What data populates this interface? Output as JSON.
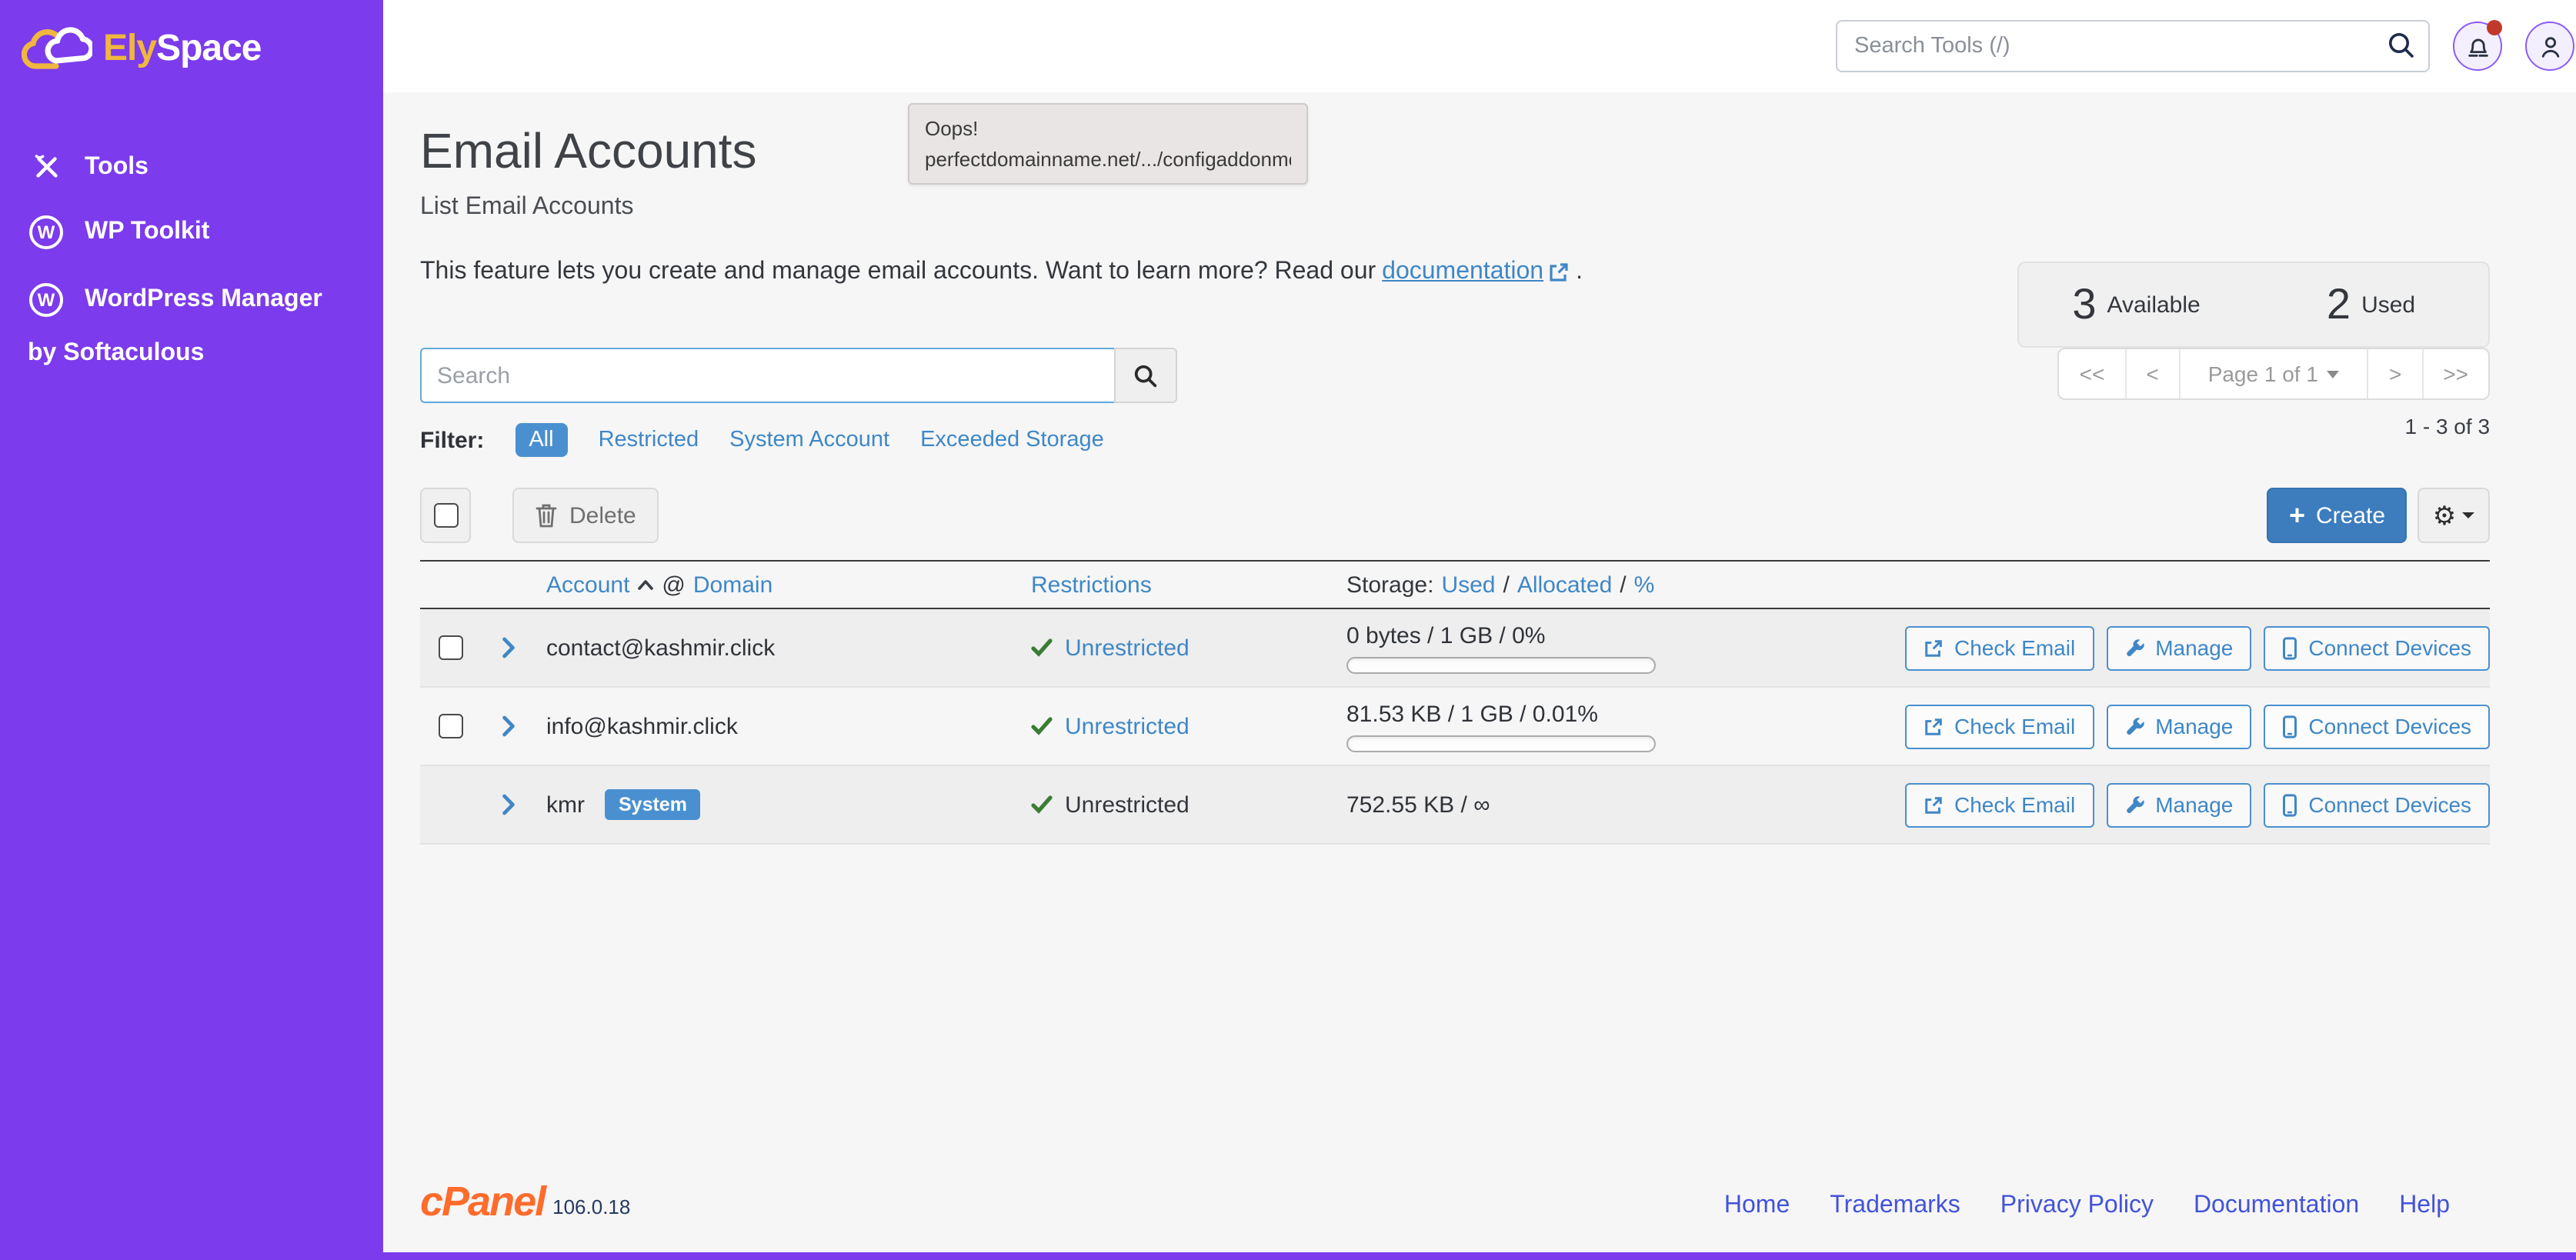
{
  "brand": {
    "name_primary": "Ely",
    "name_secondary": "Space"
  },
  "sidebar": {
    "items": [
      {
        "label": "Tools",
        "icon": "tools-icon"
      },
      {
        "label": "WP Toolkit",
        "icon": "wordpress-icon"
      },
      {
        "label": "WordPress Manager",
        "sublabel": "by Softaculous",
        "icon": "wordpress-icon"
      }
    ]
  },
  "topbar": {
    "search_placeholder": "Search Tools (/)"
  },
  "tooltip": {
    "line1": "Oops!",
    "line2": "perfectdomainname.net/.../configaddonmods...."
  },
  "page": {
    "title": "Email Accounts",
    "subtitle": "List Email Accounts",
    "description": "This feature lets you create and manage email accounts. Want to learn more? Read our",
    "doc_link": "documentation",
    "description_suffix": "."
  },
  "stats": {
    "available_value": "3",
    "available_label": "Available",
    "used_value": "2",
    "used_label": "Used"
  },
  "list_controls": {
    "search_placeholder": "Search",
    "filter_label": "Filter:",
    "filters": [
      "All",
      "Restricted",
      "System Account",
      "Exceeded Storage"
    ],
    "active_filter": "All",
    "delete_label": "Delete",
    "create_label": "Create",
    "pagination": {
      "first": "<<",
      "prev": "<",
      "page": "Page 1 of 1",
      "next": ">",
      "last": ">>",
      "range": "1 - 3 of 3"
    }
  },
  "table": {
    "header": {
      "account": "Account",
      "at": "@",
      "domain": "Domain",
      "restrictions": "Restrictions",
      "storage_label": "Storage:",
      "storage_used": "Used",
      "storage_sep1": "/",
      "storage_allocated": "Allocated",
      "storage_sep2": "/",
      "storage_percent": "%"
    },
    "rows": [
      {
        "account": "contact@kashmir.click",
        "restriction": "Unrestricted",
        "storage": "0 bytes / 1 GB / 0%"
      },
      {
        "account": "info@kashmir.click",
        "restriction": "Unrestricted",
        "storage": "81.53 KB / 1 GB / 0.01%"
      },
      {
        "account": "kmr",
        "badge": "System",
        "restriction": "Unrestricted",
        "storage": "752.55 KB / ∞"
      }
    ],
    "actions": {
      "check_email": "Check Email",
      "manage": "Manage",
      "connect_devices": "Connect Devices"
    }
  },
  "footer": {
    "logo": "cPanel",
    "version": "106.0.18",
    "links": [
      "Home",
      "Trademarks",
      "Privacy Policy",
      "Documentation",
      "Help"
    ]
  },
  "colors": {
    "sidebar_purple": "#7C3BEC",
    "brand_yellow": "#EFB73E",
    "link_blue": "#3F87C6",
    "filter_pill_blue": "#4A90D0",
    "create_button_blue": "#3D7DBE",
    "badge_blue": "#4A90D0",
    "success_green": "#3A7D34",
    "notification_red": "#C0392B",
    "footer_link_blue": "#4353D9",
    "cpanel_orange": "#FF6C2C"
  }
}
